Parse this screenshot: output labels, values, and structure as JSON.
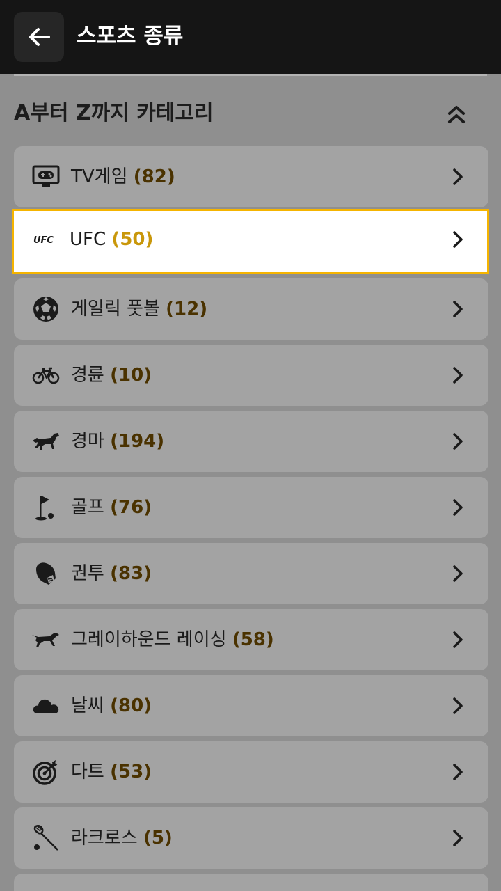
{
  "header": {
    "title": "스포츠 종류",
    "back_icon": "arrow-left-icon"
  },
  "section": {
    "title": "A부터 Z까지 카테고리",
    "collapse_icon": "chevron-double-up-icon"
  },
  "colors": {
    "accent": "#f5b400",
    "count": "#4a3200",
    "selected_count": "#c9970a"
  },
  "items": [
    {
      "label": "TV게임",
      "count": "(82)",
      "icon": "gamepad-tv-icon"
    },
    {
      "label": "UFC",
      "count": "(50)",
      "icon": "ufc-logo-icon",
      "selected": true
    },
    {
      "label": "게일릭 풋볼",
      "count": "(12)",
      "icon": "soccer-ball-icon"
    },
    {
      "label": "경륜",
      "count": "(10)",
      "icon": "bicycle-icon"
    },
    {
      "label": "경마",
      "count": "(194)",
      "icon": "horse-icon"
    },
    {
      "label": "골프",
      "count": "(76)",
      "icon": "golf-flag-icon"
    },
    {
      "label": "권투",
      "count": "(83)",
      "icon": "boxing-glove-icon"
    },
    {
      "label": "그레이하운드 레이싱",
      "count": "(58)",
      "icon": "greyhound-icon"
    },
    {
      "label": "날씨",
      "count": "(80)",
      "icon": "cloud-icon"
    },
    {
      "label": "다트",
      "count": "(53)",
      "icon": "dart-target-icon"
    },
    {
      "label": "라크로스",
      "count": "(5)",
      "icon": "lacrosse-stick-icon"
    }
  ]
}
